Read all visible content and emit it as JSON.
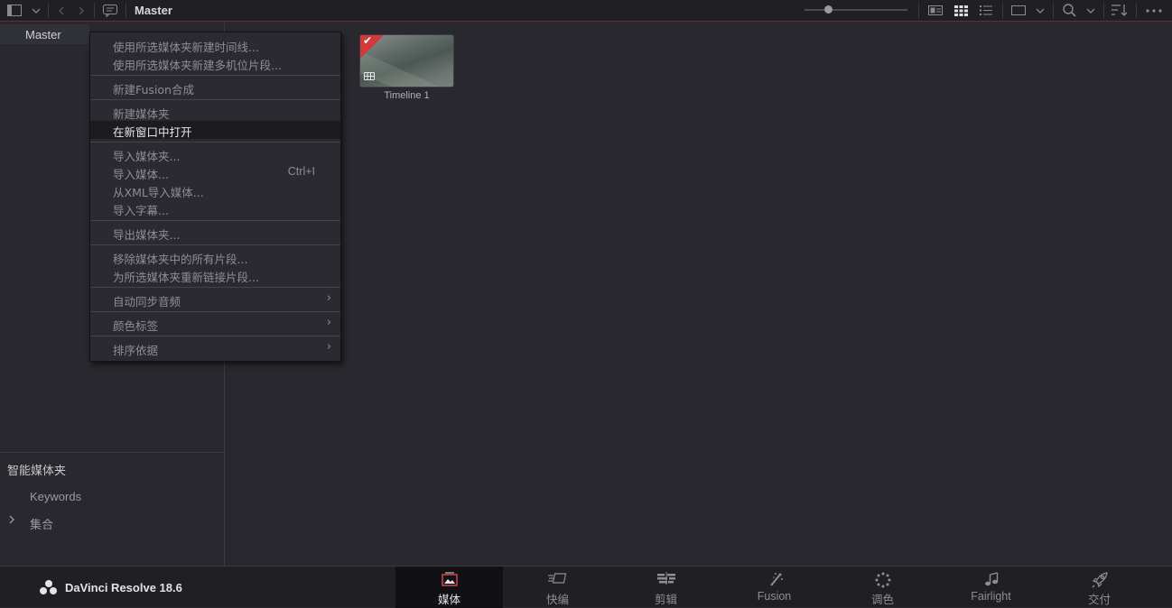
{
  "topbar": {
    "title": "Master",
    "icons": [
      "panel-toggle-icon",
      "chevron-down-icon",
      "back-icon",
      "forward-icon",
      "metadata-icon",
      "metadata-view-icon",
      "thumbnail-view-icon",
      "list-view-icon",
      "viewer-icon",
      "chevron-down-icon",
      "search-icon",
      "chevron-down-icon",
      "sort-icon",
      "more-icon"
    ],
    "zoom_level": 0.23
  },
  "sidebar": {
    "master_bin": "Master",
    "smart_bins_title": "智能媒体夹",
    "smart_bins": [
      {
        "label": "Keywords"
      },
      {
        "label": "集合"
      }
    ]
  },
  "clips": [
    {
      "name": "Timeline 1",
      "flag_color": "#d23a3a"
    }
  ],
  "context_menu": {
    "items": [
      {
        "label": "使用所选媒体夹新建时间线..."
      },
      {
        "label": "使用所选媒体夹新建多机位片段..."
      },
      {
        "label": "新建Fusion合成"
      },
      {
        "label": "新建媒体夹"
      },
      {
        "label": "在新窗口中打开"
      },
      {
        "label": "导入媒体夹..."
      },
      {
        "label": "导入媒体...",
        "shortcut": "Ctrl+I"
      },
      {
        "label": "从XML导入媒体..."
      },
      {
        "label": "导入字幕..."
      },
      {
        "label": "导出媒体夹..."
      },
      {
        "label": "移除媒体夹中的所有片段..."
      },
      {
        "label": "为所选媒体夹重新链接片段..."
      },
      {
        "label": "自动同步音频"
      },
      {
        "label": "颜色标签"
      },
      {
        "label": "排序依据"
      }
    ],
    "highlighted": "在新窗口中打开"
  },
  "bottombar": {
    "brand": "DaVinci Resolve 18.6",
    "pages": [
      {
        "label": "媒体",
        "icon": "media-page-icon",
        "active": true
      },
      {
        "label": "快编",
        "icon": "cut-page-icon"
      },
      {
        "label": "剪辑",
        "icon": "edit-page-icon"
      },
      {
        "label": "Fusion",
        "icon": "fusion-page-icon"
      },
      {
        "label": "调色",
        "icon": "color-page-icon"
      },
      {
        "label": "Fairlight",
        "icon": "fairlight-page-icon"
      },
      {
        "label": "交付",
        "icon": "deliver-page-icon"
      }
    ]
  },
  "colors": {
    "accent_red": "#d23a3a",
    "panel_bg": "#28282e",
    "bar_bg": "#1f1f24"
  }
}
